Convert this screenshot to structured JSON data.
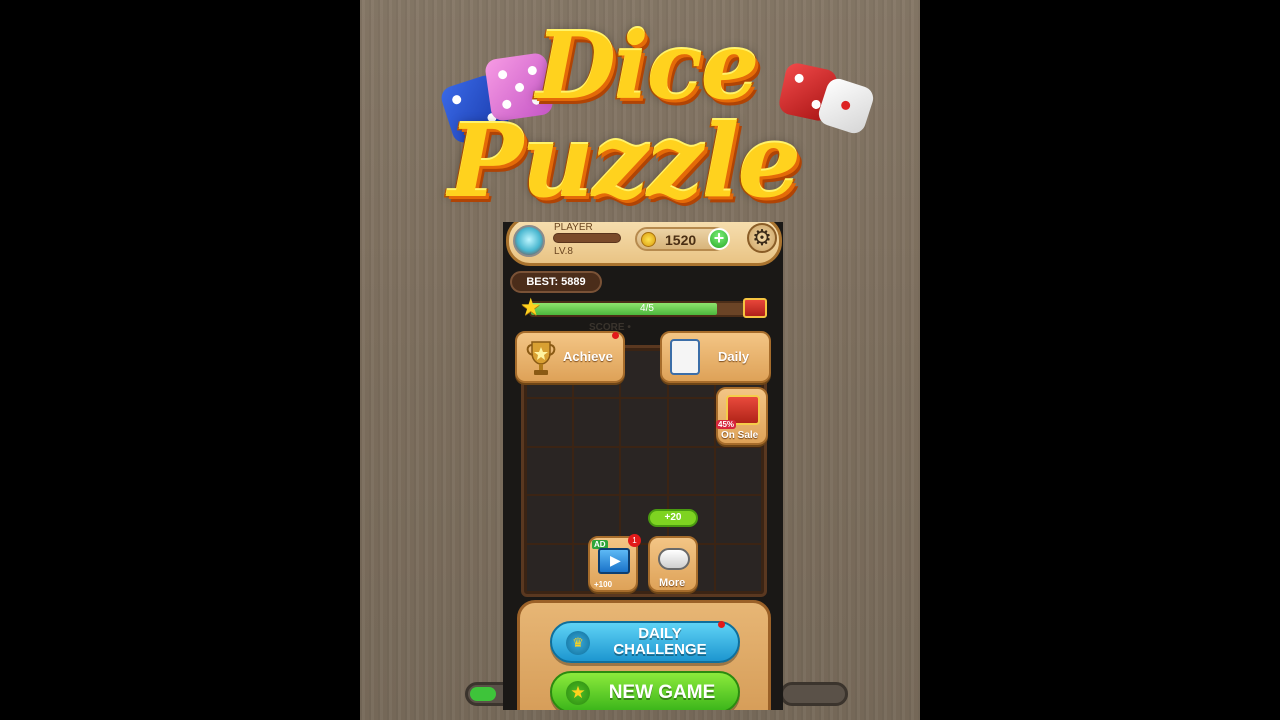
{
  "logo": {
    "line1": "Dice",
    "line2": "Puzzle"
  },
  "header": {
    "player_name": "PLAYER",
    "level": "LV.8",
    "coins": "1520",
    "add_symbol": "+",
    "settings_symbol": "⚙"
  },
  "best": "BEST: 5889",
  "progress": {
    "text": "4/5",
    "fraction": 0.8
  },
  "score_ghost": "SCORE •",
  "menu": {
    "achieve": "Achieve",
    "daily": "Daily",
    "sale_discount": "45%",
    "sale": "On Sale",
    "ad_tag": "AD",
    "ad_count": "1",
    "ad_reward": "+100",
    "more": "More",
    "more_reward": "+20"
  },
  "buttons": {
    "daily_challenge_line1": "DAILY",
    "daily_challenge_line2": "CHALLENGE",
    "new_game": "NEW GAME"
  },
  "colors": {
    "accent_gold": "#ffd21e",
    "progress_green": "#4cb63c",
    "challenge_blue": "#1d96d0",
    "new_game_green": "#3bb51a"
  }
}
